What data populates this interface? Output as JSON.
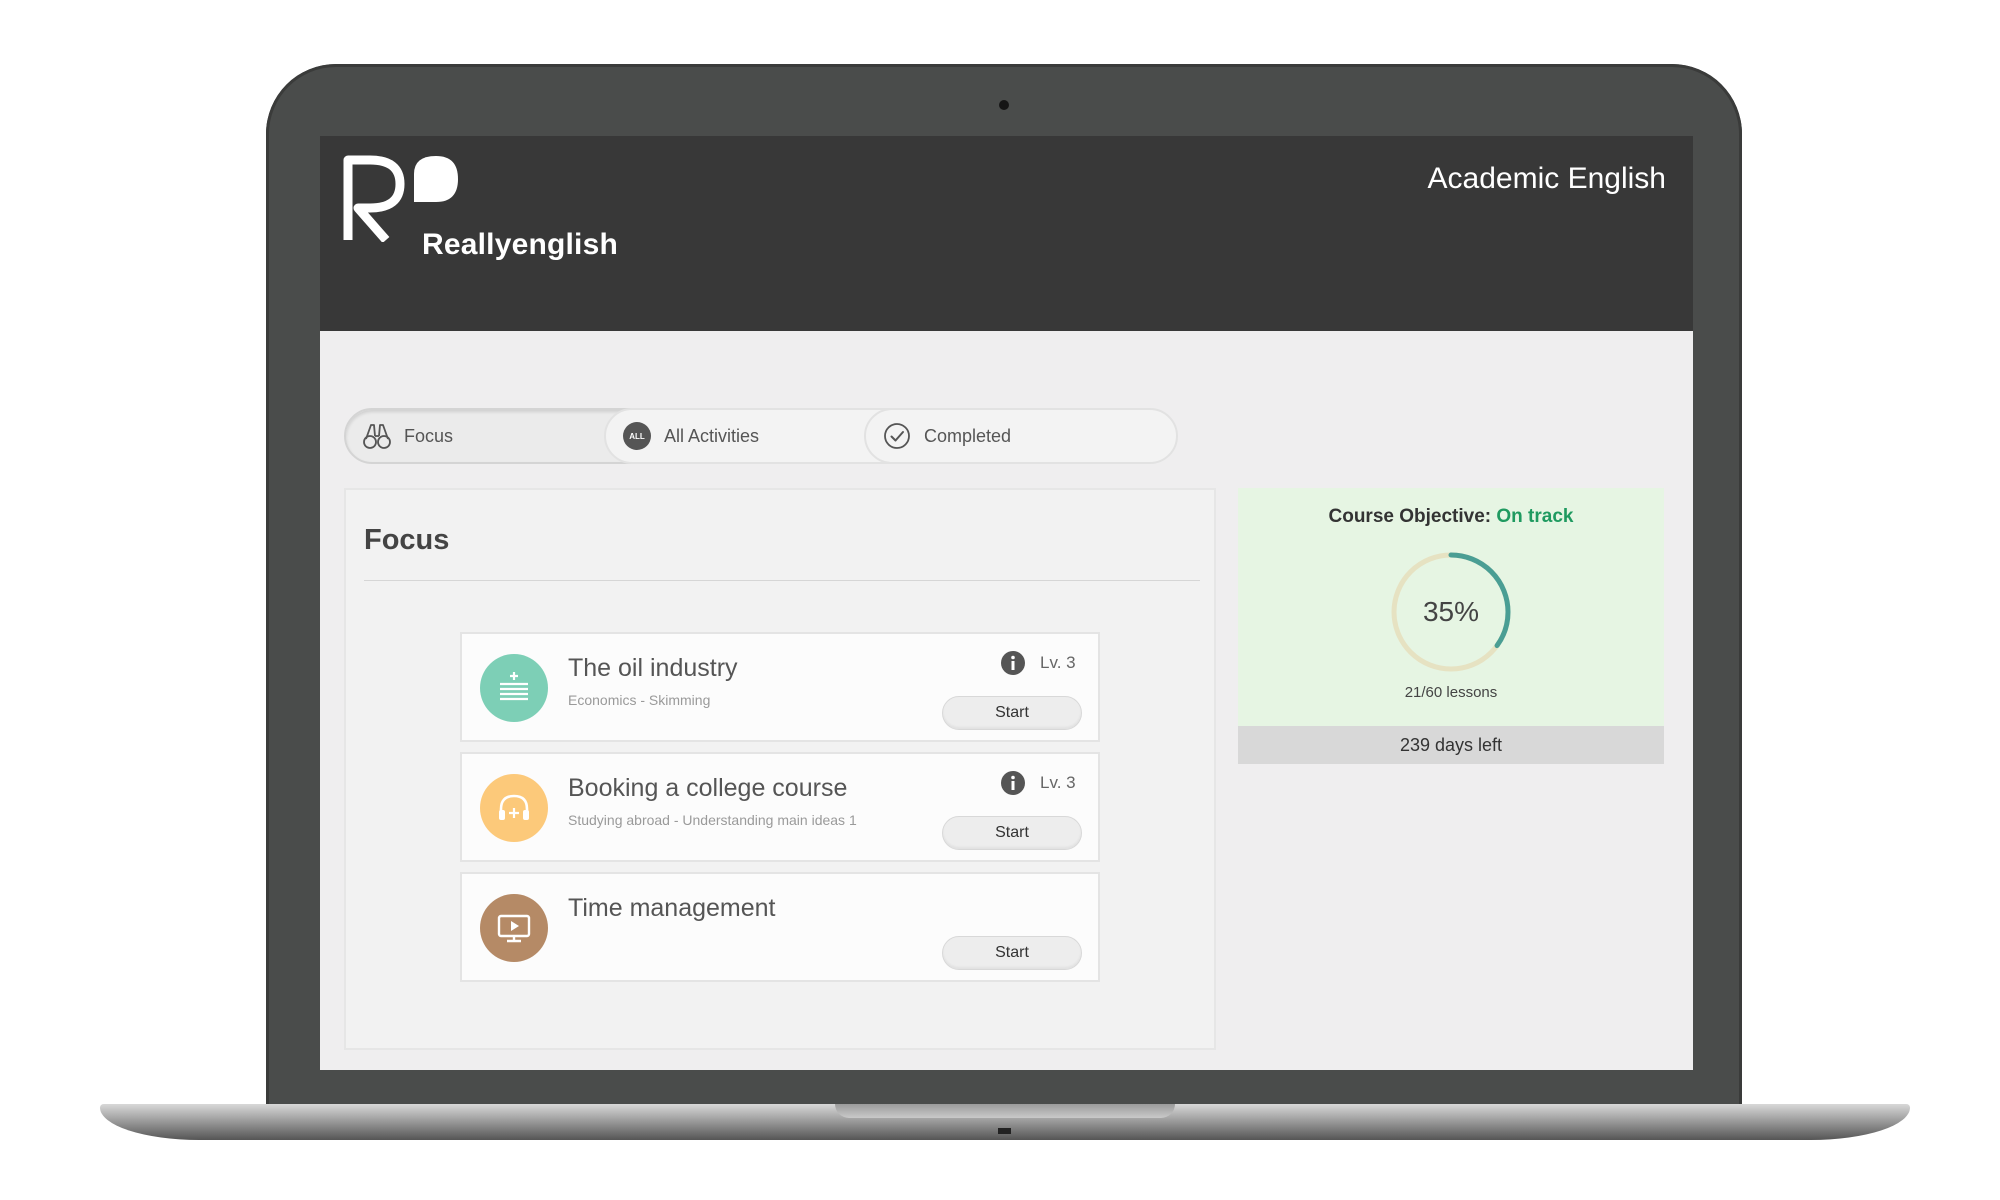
{
  "header": {
    "brand": "Reallyenglish",
    "course_title": "Academic English"
  },
  "tabs": [
    {
      "label": "Focus",
      "icon": "binoculars-icon",
      "active": true
    },
    {
      "label": "All Activities",
      "icon": "all-badge-icon",
      "badge": "ALL",
      "active": false
    },
    {
      "label": "Completed",
      "icon": "check-circle-icon",
      "active": false
    }
  ],
  "focus": {
    "title": "Focus",
    "cards": [
      {
        "title": "The oil industry",
        "subtitle": "Economics - Skimming",
        "level": "Lv. 3",
        "button": "Start",
        "icon": "reading-icon",
        "color": "#7dcfb6"
      },
      {
        "title": "Booking a college course",
        "subtitle": "Studying abroad - Understanding main ideas 1",
        "level": "Lv. 3",
        "button": "Start",
        "icon": "headphones-icon",
        "color": "#fcc97a"
      },
      {
        "title": "Time management",
        "subtitle": "",
        "level": "",
        "button": "Start",
        "icon": "video-icon",
        "color": "#b58a66"
      }
    ]
  },
  "objective": {
    "label": "Course Objective: ",
    "status": "On track",
    "percent_label": "35%",
    "progress": 0.35,
    "lessons": "21/60 lessons",
    "days_left": "239 days left"
  },
  "colors": {
    "header_bg": "#383838",
    "status_green": "#1f9a60",
    "ring_progress": "#4a9e94",
    "ring_track": "#e6e2c2",
    "objective_bg": "#e6f5e3"
  }
}
